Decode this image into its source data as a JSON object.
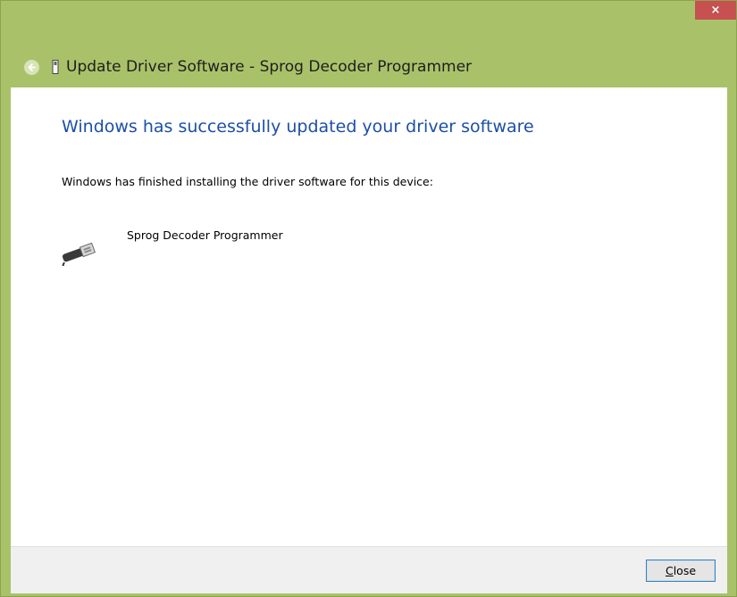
{
  "window": {
    "title": "Update Driver Software - Sprog Decoder Programmer",
    "close_glyph": "×",
    "accent": "#a9c26a",
    "close_color": "#c75050"
  },
  "content": {
    "heading": "Windows has successfully updated your driver software",
    "description": "Windows has finished installing the driver software for this device:",
    "device_name": "Sprog Decoder Programmer",
    "device_icon": "usb-device-icon",
    "heading_color": "#1c4fa6"
  },
  "footer": {
    "close_label_underlined": "C",
    "close_label_rest": "lose"
  }
}
